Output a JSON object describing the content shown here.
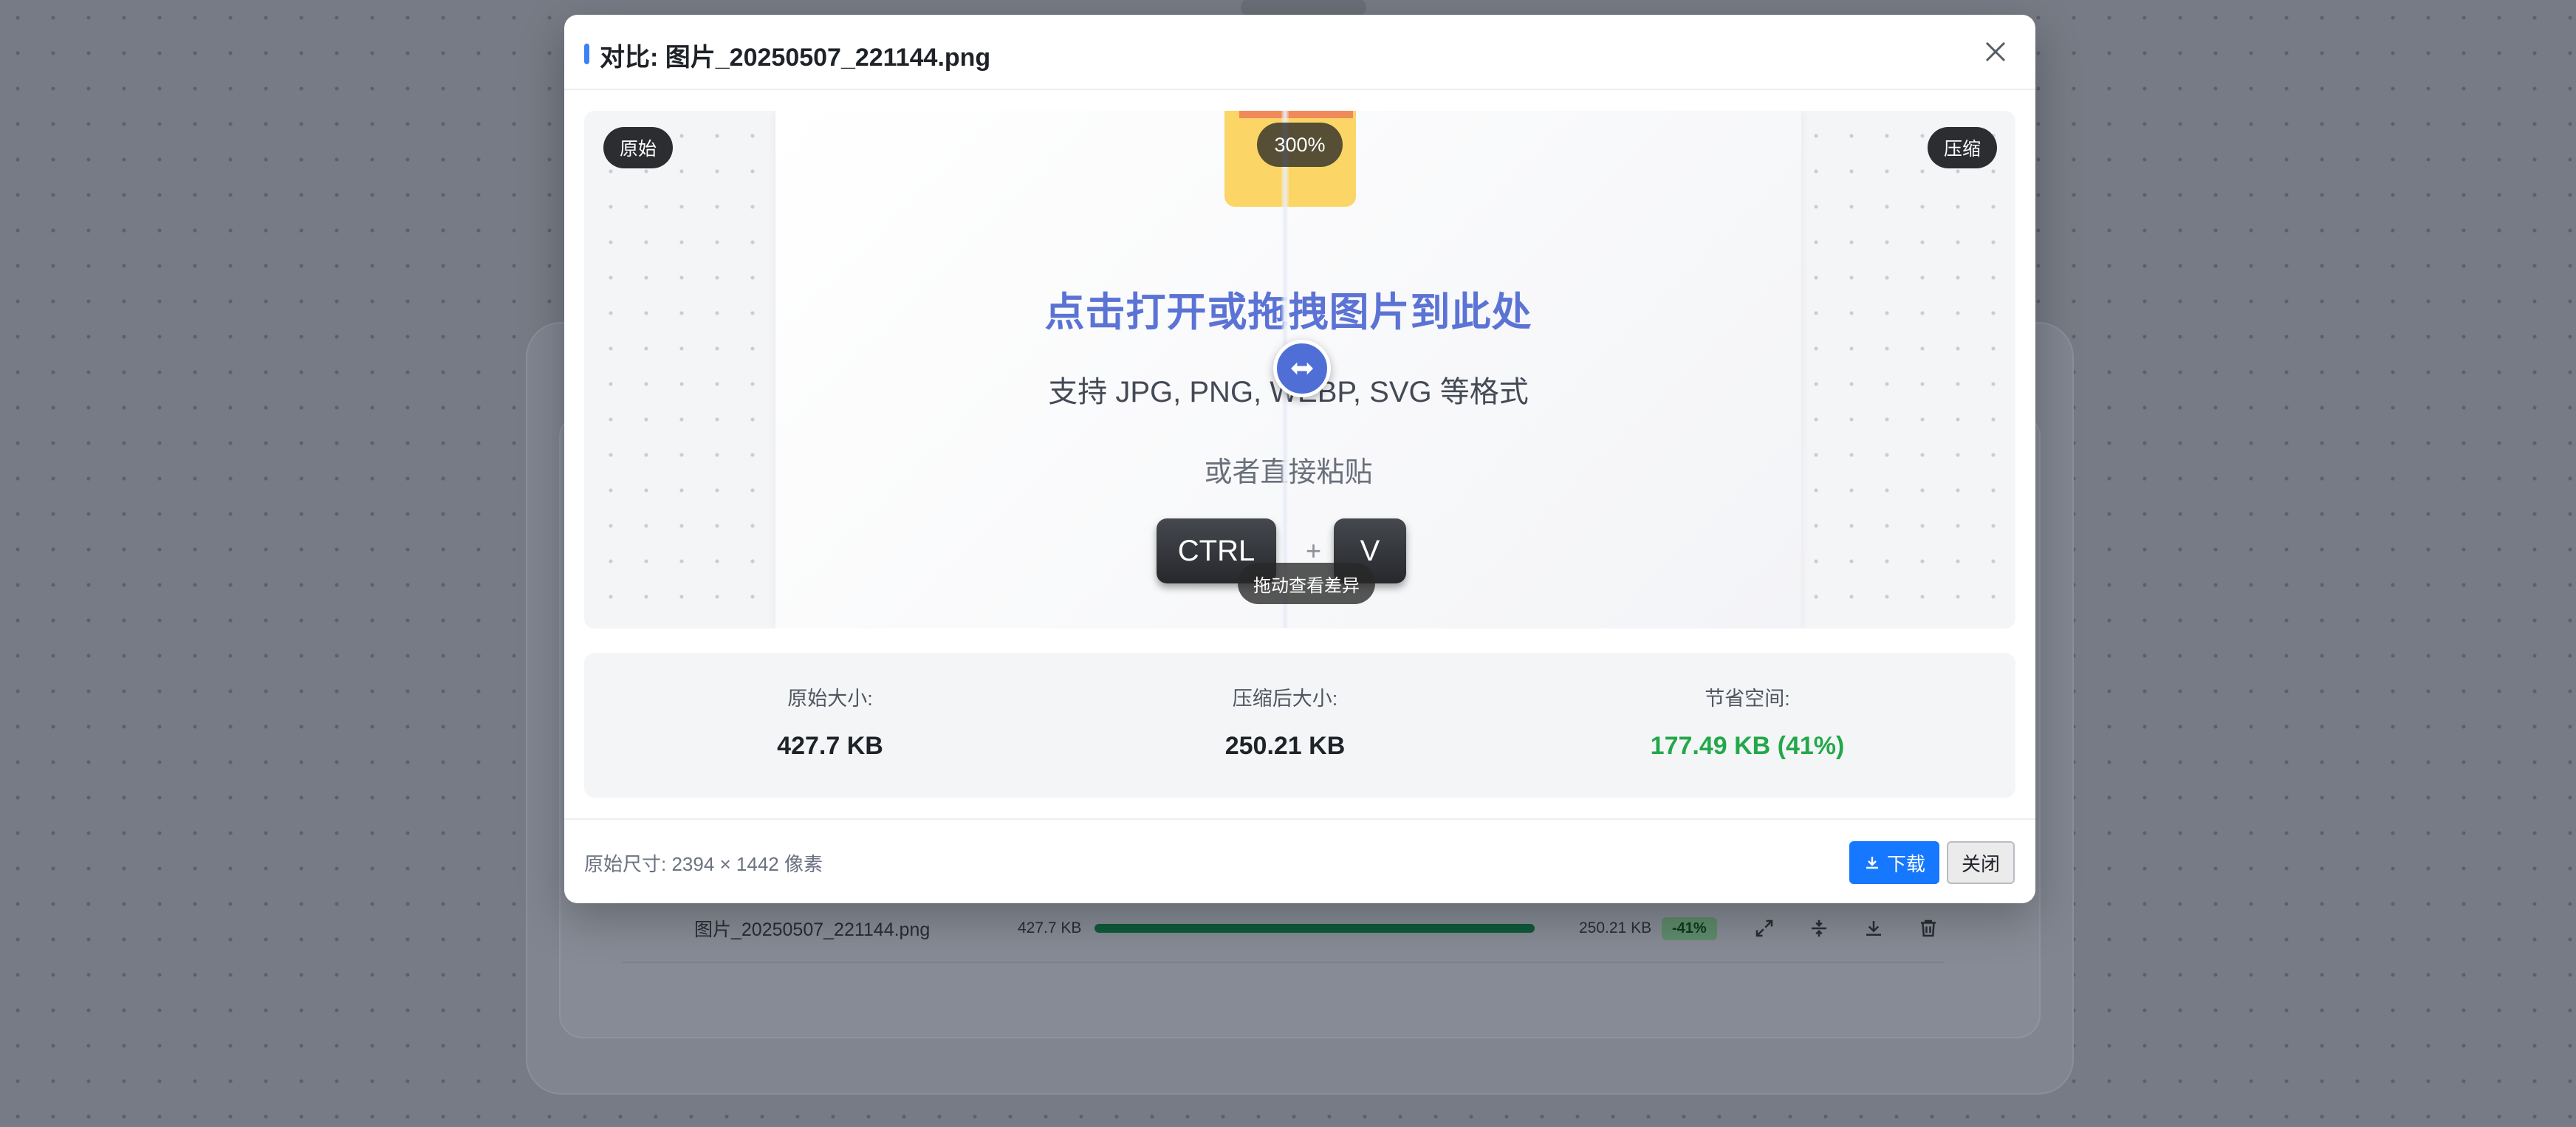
{
  "background": {
    "file_row": {
      "file_name": "图片_20250507_221144.png",
      "original_size": "427.7 KB",
      "progress_fraction": 1.0,
      "compressed_size": "250.21 KB",
      "savings_badge": "-41%",
      "icons": [
        "expand-icon",
        "compare-icon",
        "download-icon",
        "trash-icon"
      ]
    }
  },
  "modal": {
    "title": "对比: 图片_20250507_221144.png",
    "close_icon": "close-icon",
    "compare": {
      "left_tag": "原始",
      "right_tag": "压缩",
      "zoom_label": "300%",
      "drag_hint": "拖动查看差异",
      "preview": {
        "headline": "点击打开或拖拽图片到此处",
        "support_text": "支持 JPG, PNG, WEBP, SVG 等格式",
        "paste_text": "或者直接粘贴",
        "key_ctrl": "CTRL",
        "key_plus": "+",
        "key_v": "V"
      }
    },
    "stats": {
      "original_label": "原始大小:",
      "original_value": "427.7 KB",
      "compressed_label": "压缩后大小:",
      "compressed_value": "250.21 KB",
      "saved_label": "节省空间:",
      "saved_value": "177.49 KB (41%)"
    },
    "footer": {
      "dimensions_text": "原始尺寸: 2394 × 1442 像素",
      "download_label": "下载",
      "close_label": "关闭"
    }
  },
  "colors": {
    "accent": "#3b82f6",
    "primary_button": "#1677ff",
    "savings_green": "#22a84a",
    "headline_blue": "#5b73d4"
  }
}
